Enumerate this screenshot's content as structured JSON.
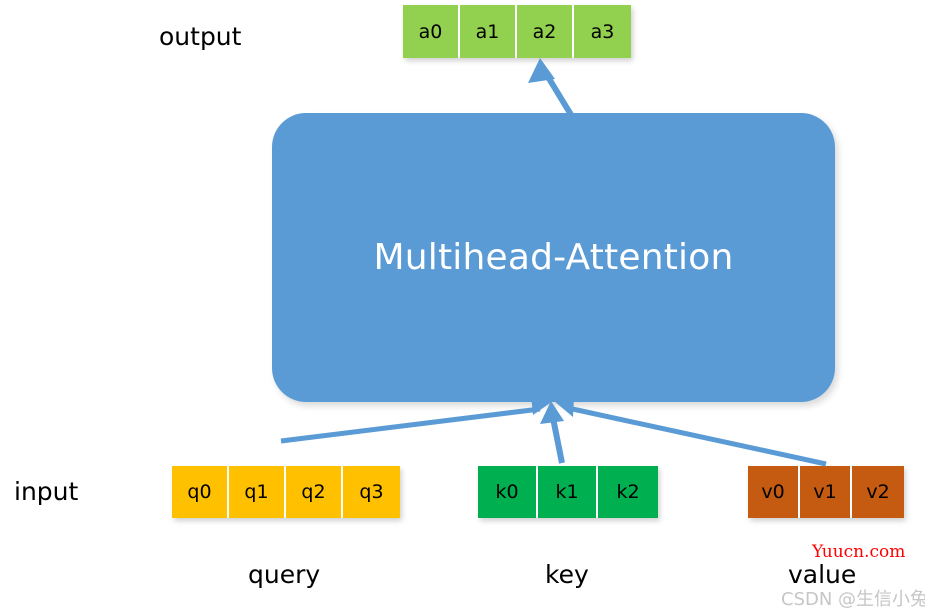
{
  "diagram": {
    "title": "Multihead-Attention",
    "colors": {
      "output_box": "#92D050",
      "query_box": "#FFC000",
      "key_box": "#00B050",
      "value_box": "#C55A11",
      "attention_block": "#5B9BD5",
      "arrow": "#5B9BD5",
      "text_dark": "#000000",
      "text_light": "#FFFFFF",
      "watermark_red": "#FF0000",
      "watermark_gray": "#C6C6C6"
    },
    "labels": {
      "output": "output",
      "input": "input",
      "query": "query",
      "key": "key",
      "value": "value"
    },
    "attention": {
      "name": "Multihead-Attention"
    },
    "rows": {
      "output": {
        "label": "output",
        "tokens": [
          "a0",
          "a1",
          "a2",
          "a3"
        ]
      },
      "query": {
        "label": "query",
        "tokens": [
          "q0",
          "q1",
          "q2",
          "q3"
        ]
      },
      "key": {
        "label": "key",
        "tokens": [
          "k0",
          "k1",
          "k2"
        ]
      },
      "value": {
        "label": "value",
        "tokens": [
          "v0",
          "v1",
          "v2"
        ]
      }
    },
    "arrows": [
      {
        "name": "attention-to-output",
        "from": "attention-block",
        "to": "output-row"
      },
      {
        "name": "query-to-attention",
        "from": "query-row",
        "to": "attention-block"
      },
      {
        "name": "key-to-attention",
        "from": "key-row",
        "to": "attention-block"
      },
      {
        "name": "value-to-attention",
        "from": "value-row",
        "to": "attention-block"
      }
    ],
    "watermarks": {
      "site": "Yuucn.com",
      "author": "CSDN @生信小兔"
    }
  }
}
